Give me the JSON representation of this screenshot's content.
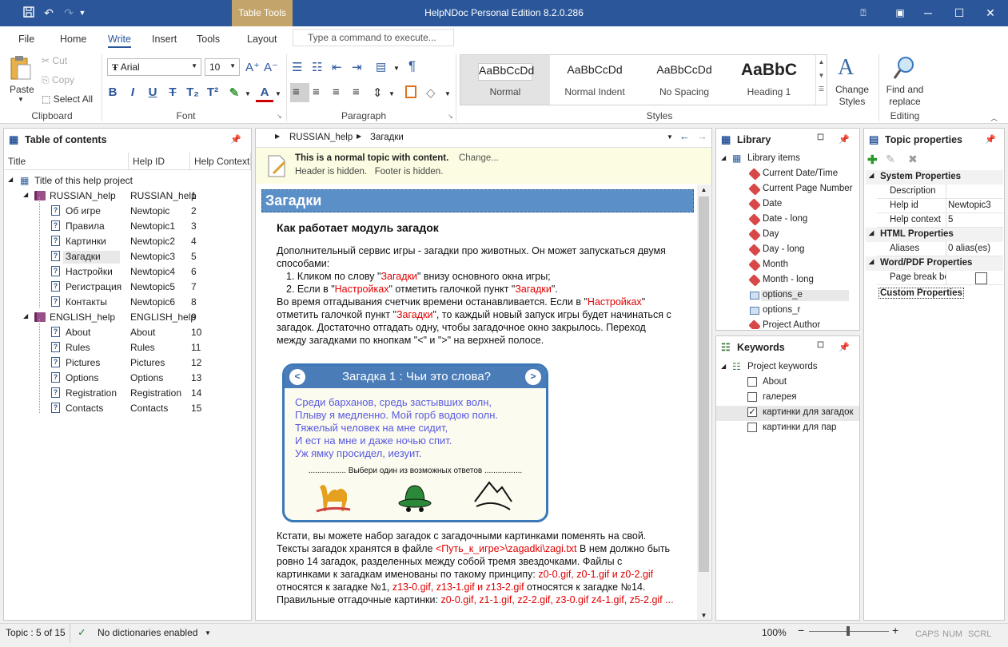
{
  "titlebar": {
    "table_tools": "Table Tools",
    "title": "HelpNDoc Personal Edition 8.2.0.286"
  },
  "menu": {
    "items": [
      "File",
      "Home",
      "Write",
      "Insert",
      "Tools",
      "Layout"
    ],
    "active": "Write",
    "command_placeholder": "Type a command to execute..."
  },
  "ribbon": {
    "clipboard": {
      "paste": "Paste",
      "cut": "Cut",
      "copy": "Copy",
      "select_all": "Select All",
      "label": "Clipboard"
    },
    "font": {
      "family": "Arial",
      "size": "10",
      "label": "Font"
    },
    "paragraph": {
      "label": "Paragraph"
    },
    "styles": {
      "label": "Styles",
      "items": [
        {
          "preview": "AaBbCcDd",
          "name": "Normal"
        },
        {
          "preview": "AaBbCcDd",
          "name": "Normal Indent"
        },
        {
          "preview": "AaBbCcDd",
          "name": "No Spacing"
        },
        {
          "preview": "AaBbC",
          "name": "Heading 1"
        }
      ],
      "change_styles": "Change Styles"
    },
    "editing": {
      "find_replace": "Find and replace",
      "label": "Editing"
    }
  },
  "toc": {
    "title": "Table of contents",
    "columns": [
      "Title",
      "Help ID",
      "Help Context"
    ],
    "root": "Title of this help project",
    "rows": [
      {
        "title": "RUSSIAN_help",
        "id": "RUSSIAN_help",
        "ctx": "1",
        "level": 1,
        "type": "book"
      },
      {
        "title": "Об игре",
        "id": "Newtopic",
        "ctx": "2",
        "level": 2,
        "type": "topic"
      },
      {
        "title": "Правила",
        "id": "Newtopic1",
        "ctx": "3",
        "level": 2,
        "type": "topic"
      },
      {
        "title": "Картинки",
        "id": "Newtopic2",
        "ctx": "4",
        "level": 2,
        "type": "topic"
      },
      {
        "title": "Загадки",
        "id": "Newtopic3",
        "ctx": "5",
        "level": 2,
        "type": "topic",
        "selected": true
      },
      {
        "title": "Настройки",
        "id": "Newtopic4",
        "ctx": "6",
        "level": 2,
        "type": "topic"
      },
      {
        "title": "Регистрация",
        "id": "Newtopic5",
        "ctx": "7",
        "level": 2,
        "type": "topic"
      },
      {
        "title": "Контакты",
        "id": "Newtopic6",
        "ctx": "8",
        "level": 2,
        "type": "topic"
      },
      {
        "title": "ENGLISH_help",
        "id": "ENGLISH_help",
        "ctx": "9",
        "level": 1,
        "type": "book"
      },
      {
        "title": "About",
        "id": "About",
        "ctx": "10",
        "level": 2,
        "type": "topic"
      },
      {
        "title": "Rules",
        "id": "Rules",
        "ctx": "11",
        "level": 2,
        "type": "topic"
      },
      {
        "title": "Pictures",
        "id": "Pictures",
        "ctx": "12",
        "level": 2,
        "type": "topic"
      },
      {
        "title": "Options",
        "id": "Options",
        "ctx": "13",
        "level": 2,
        "type": "topic"
      },
      {
        "title": "Registration",
        "id": "Registration",
        "ctx": "14",
        "level": 2,
        "type": "topic"
      },
      {
        "title": "Contacts",
        "id": "Contacts",
        "ctx": "15",
        "level": 2,
        "type": "topic"
      }
    ]
  },
  "editor": {
    "breadcrumb": [
      "RUSSIAN_help",
      "Загадки"
    ],
    "info_line1": "This is a normal topic with content.",
    "change": "Change...",
    "info_line2": "Header is hidden.   Footer is hidden.",
    "heading": "Загадки",
    "subheading": "Как работает модуль загадок",
    "p1": "Дополнительный сервис игры - загадки про животных. Он может запускаться двумя способами:",
    "li1a": "Кликом по слову \"",
    "li1b": "Загадки",
    "li1c": "\" внизу основного окна игры;",
    "li2a": "Если в \"",
    "li2b": "Настройках",
    "li2c": "\" отметить галочкой пункт \"",
    "li2d": "Загадки",
    "li2e": "\".",
    "p2a": "Во время отгадывания счетчик времени останавливается. Если в \"",
    "p2b": "Настройках",
    "p2c": "\" отметить галочкой пункт \"",
    "p2d": "Загадки",
    "p2e": "\", то каждый новый запуск игры будет начинаться с загадок. Достаточно отгадать одну, чтобы загадочное окно закрылось. Переход между загадками по кнопкам \"<\" и \">\" на верхней полосе.",
    "riddle": {
      "title": "Загадка 1 : Чьи это слова?",
      "lines": [
        "Среди барханов, средь застывших волн,",
        "Плыву я медленно. Мой горб водою полн.",
        "Тяжелый человек на мне сидит,",
        "И ест на мне и даже ночью спит.",
        "Уж ямку просидел, иезуит."
      ],
      "choose": "................. Выбери один из возможных ответов ................."
    },
    "p3a": "Кстати, вы можете набор загадок с загадочными картинками поменять на свой. Тексты загадок хранятся в файле ",
    "p3b": "<Путь_к_игре>\\zagadki\\zagi.txt",
    "p3c": " В нем должно быть ровно 14 загадок, разделенных между собой тремя звездочками. Файлы с картинками к загадкам именованы по такому принципу: ",
    "p3d": "z0-0.gif, z0-1.gif и z0-2.gif",
    "p3e": " относятся к загадке №1, ",
    "p3f": "z13-0.gif, z13-1.gif и z13-2.gif",
    "p3g": " относятся к загадке №14. Правильные отгадочные картинки: ",
    "p3h": "z0-0.gif, z1-1.gif, z2-2.gif, z3-0.gif z4-1.gif, z5-2.gif ..."
  },
  "library": {
    "title": "Library",
    "root": "Library items",
    "items": [
      {
        "name": "Current Date/Time",
        "type": "tag"
      },
      {
        "name": "Current Page Number",
        "type": "tag"
      },
      {
        "name": "Date",
        "type": "tag"
      },
      {
        "name": "Date - long",
        "type": "tag"
      },
      {
        "name": "Day",
        "type": "tag"
      },
      {
        "name": "Day - long",
        "type": "tag"
      },
      {
        "name": "Month",
        "type": "tag"
      },
      {
        "name": "Month - long",
        "type": "tag"
      },
      {
        "name": "options_e",
        "type": "img",
        "selected": true
      },
      {
        "name": "options_r",
        "type": "img"
      },
      {
        "name": "Project Author",
        "type": "tag"
      }
    ]
  },
  "keywords": {
    "title": "Keywords",
    "root": "Project keywords",
    "items": [
      {
        "name": "About",
        "checked": false
      },
      {
        "name": "галерея",
        "checked": false
      },
      {
        "name": "картинки для загадок",
        "checked": true
      },
      {
        "name": "картинки для пар",
        "checked": false
      }
    ]
  },
  "props": {
    "title": "Topic properties",
    "system": "System Properties",
    "description": "Description",
    "help_id_label": "Help id",
    "help_id": "Newtopic3",
    "help_ctx_label": "Help context",
    "help_ctx": "5",
    "html": "HTML Properties",
    "aliases_label": "Aliases",
    "aliases": "0 alias(es)",
    "wordpdf": "Word/PDF Properties",
    "pagebreak": "Page break be",
    "custom": "Custom Properties"
  },
  "status": {
    "topic": "Topic : 5 of 15",
    "dict": "No dictionaries enabled",
    "zoom": "100%",
    "caps": "CAPS",
    "num": "NUM",
    "scrl": "SCRL"
  }
}
